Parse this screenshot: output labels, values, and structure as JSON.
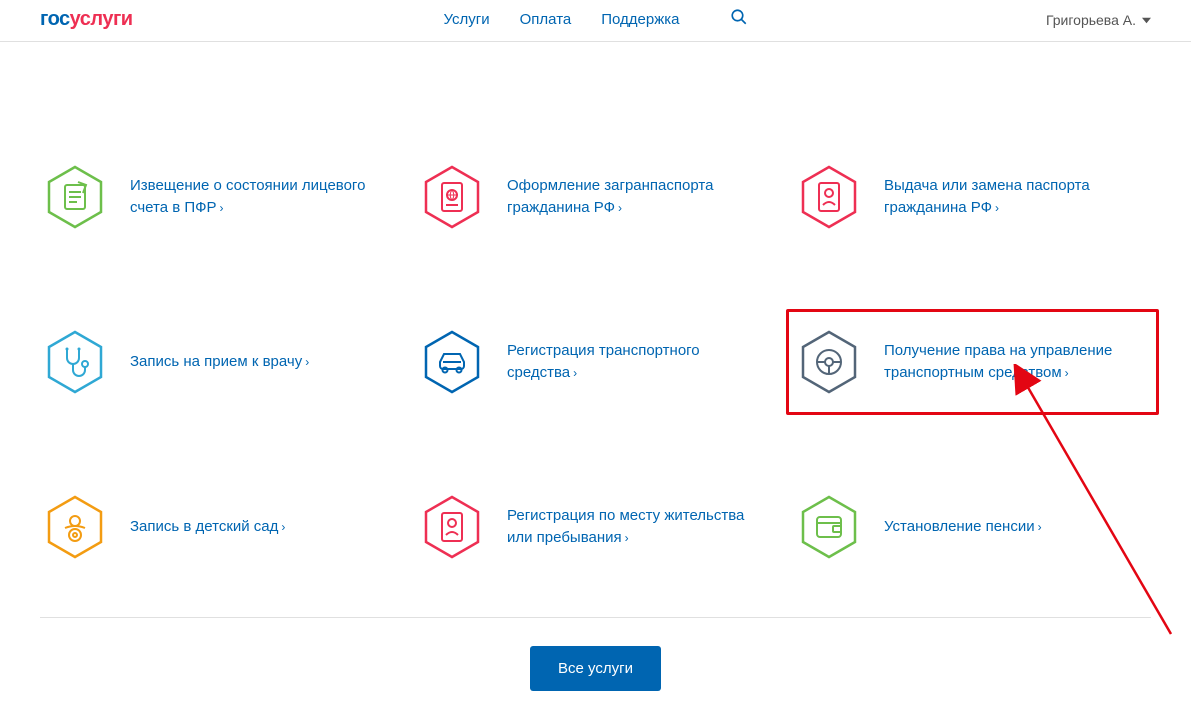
{
  "logo": {
    "part1": "гос",
    "part2": "услуги"
  },
  "nav": {
    "services": "Услуги",
    "payment": "Оплата",
    "support": "Поддержка"
  },
  "user": {
    "name": "Григорьева А."
  },
  "services": [
    {
      "label": "Извещение о состоянии лицевого счета в ПФР",
      "color": "#6dbf4b"
    },
    {
      "label": "Оформление загранпаспорта гражданина РФ",
      "color": "#ee2f53"
    },
    {
      "label": "Выдача или замена паспорта гражданина РФ",
      "color": "#ee2f53"
    },
    {
      "label": "Запись на прием к врачу",
      "color": "#2fa8d4"
    },
    {
      "label": "Регистрация транспортного средства",
      "color": "#0065b1"
    },
    {
      "label": "Получение права на управление транспортным средством",
      "color": "#536578",
      "highlighted": true
    },
    {
      "label": "Запись в детский сад",
      "color": "#f39c12"
    },
    {
      "label": "Регистрация по месту жительства или пребывания",
      "color": "#ee2f53"
    },
    {
      "label": "Установление пенсии",
      "color": "#6dbf4b"
    }
  ],
  "all_button": "Все услуги",
  "chevron": "›"
}
